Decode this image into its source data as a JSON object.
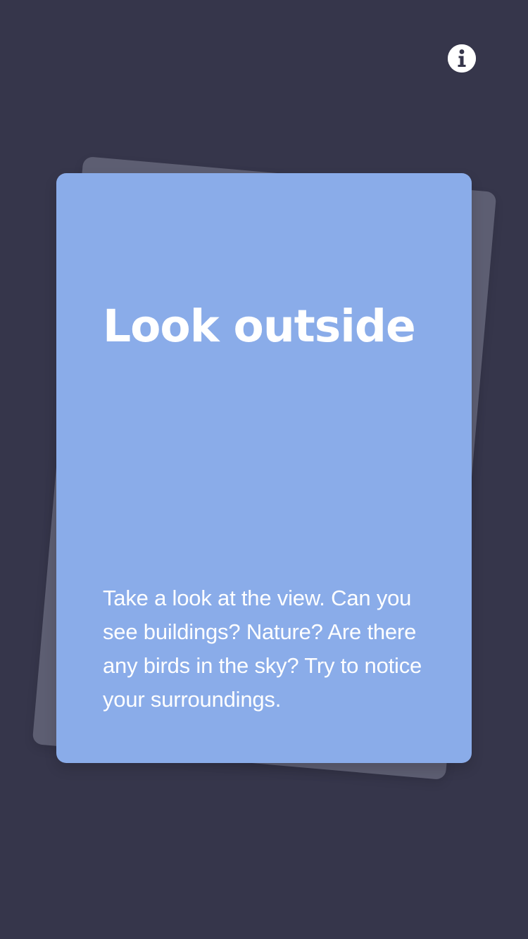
{
  "top_bar": {
    "info_icon": "info-icon"
  },
  "card": {
    "title": "Look outside",
    "body": "Take a look at the view. Can you see buildings? Nature? Are there any birds in the sky? Try to notice your surroundings."
  },
  "colors": {
    "background": "#36364b",
    "card_front": "#8aace9",
    "card_back": "#5d5e72",
    "text": "#ffffff"
  }
}
